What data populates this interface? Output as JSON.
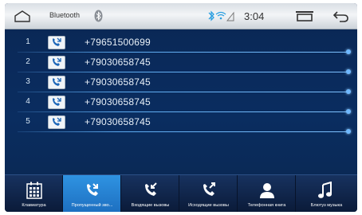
{
  "status_bar": {
    "title": "Bluetooth",
    "time": "3:04",
    "icons": [
      "home-icon",
      "bluetooth-device-icon",
      "bluetooth-icon",
      "wifi-icon",
      "signal-icon",
      "recent-apps-icon",
      "back-icon"
    ]
  },
  "calls": [
    {
      "index": "1",
      "number": "+79651500699",
      "icon": "missed-call-icon"
    },
    {
      "index": "2",
      "number": "+79030658745",
      "icon": "missed-call-icon"
    },
    {
      "index": "3",
      "number": "+79030658745",
      "icon": "missed-call-icon"
    },
    {
      "index": "4",
      "number": "+79030658745",
      "icon": "missed-call-icon"
    },
    {
      "index": "5",
      "number": "+79030658745",
      "icon": "missed-call-icon"
    }
  ],
  "tabs": [
    {
      "label": "Клавиатура",
      "icon": "keypad-icon",
      "active": false
    },
    {
      "label": "Пропущенный зво...",
      "icon": "missed-call-icon",
      "active": true
    },
    {
      "label": "Входящие вызовы",
      "icon": "incoming-call-icon",
      "active": false
    },
    {
      "label": "Исходящие вызовы",
      "icon": "outgoing-call-icon",
      "active": false
    },
    {
      "label": "Телефонная книга",
      "icon": "contacts-icon",
      "active": false
    },
    {
      "label": "Блютуз музыка",
      "icon": "music-icon",
      "active": false
    }
  ],
  "colors": {
    "background": "#0a2a5b",
    "active_tab": "#2f93e2",
    "accent_line": "#5aa8ee"
  }
}
